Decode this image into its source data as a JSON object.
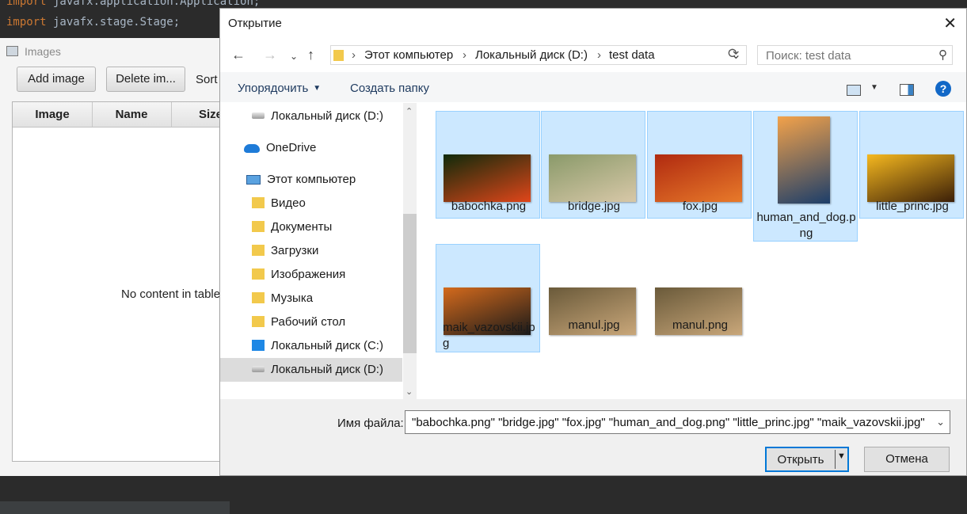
{
  "background_code": {
    "line1": {
      "kw": "import",
      "rest": " javafx.application.Application;"
    },
    "line2": {
      "kw": "import",
      "rest": " javafx.stage.Stage;"
    }
  },
  "app": {
    "title": "Images",
    "buttons": {
      "add": "Add image",
      "delete": "Delete im...",
      "sort": "Sort"
    },
    "table": {
      "columns": [
        "Image",
        "Name",
        "Size"
      ],
      "empty_text": "No content in table"
    }
  },
  "dialog": {
    "title": "Открытие",
    "close_icon": "close-icon",
    "address": {
      "crumbs": [
        "Этот компьютер",
        "Локальный диск (D:)",
        "test data"
      ]
    },
    "search": {
      "placeholder": "Поиск: test data"
    },
    "toolbar": {
      "organize": "Упорядочить",
      "new_folder": "Создать папку"
    },
    "nav_items": [
      {
        "label": "Локальный диск (D:)",
        "icon": "drive-icon"
      },
      {
        "label": "OneDrive",
        "icon": "cloud-icon"
      },
      {
        "label": "Этот компьютер",
        "icon": "computer-icon"
      },
      {
        "label": "Видео",
        "icon": "video-folder-icon"
      },
      {
        "label": "Документы",
        "icon": "documents-folder-icon"
      },
      {
        "label": "Загрузки",
        "icon": "downloads-folder-icon"
      },
      {
        "label": "Изображения",
        "icon": "pictures-folder-icon"
      },
      {
        "label": "Музыка",
        "icon": "music-folder-icon"
      },
      {
        "label": "Рабочий стол",
        "icon": "desktop-folder-icon"
      },
      {
        "label": "Локальный диск (C:)",
        "icon": "windows-drive-icon"
      },
      {
        "label": "Локальный диск (D:)",
        "icon": "drive-icon",
        "selected": true
      }
    ],
    "files": [
      {
        "name": "babochka.png",
        "selected": true,
        "thumb": [
          "#0f2a0a",
          "#e0461a"
        ]
      },
      {
        "name": "bridge.jpg",
        "selected": true,
        "thumb": [
          "#8a9a6a",
          "#d8c8a8"
        ]
      },
      {
        "name": "fox.jpg",
        "selected": true,
        "thumb": [
          "#b02a10",
          "#e87a2a"
        ]
      },
      {
        "name": "human_and_dog.png",
        "selected": true,
        "thumb": [
          "#f3a24a",
          "#1c3e6a"
        ]
      },
      {
        "name": "little_princ.jpg",
        "selected": true,
        "thumb": [
          "#f5b81f",
          "#3b1f08"
        ]
      },
      {
        "name": "maik_vazovskii.jpg",
        "selected": true,
        "thumb": [
          "#d46a1c",
          "#1a1a1a"
        ]
      },
      {
        "name": "manul.jpg",
        "selected": false,
        "thumb": [
          "#6a5a3a",
          "#c9a77a"
        ]
      },
      {
        "name": "manul.png",
        "selected": false,
        "thumb": [
          "#6a5a3a",
          "#c9a77a"
        ]
      }
    ],
    "filename_label": "Имя файла:",
    "filename_value": "\"babochka.png\" \"bridge.jpg\" \"fox.jpg\" \"human_and_dog.png\" \"little_princ.jpg\" \"maik_vazovskii.jpg\"",
    "buttons": {
      "open": "Открыть",
      "cancel": "Отмена"
    },
    "colors": {
      "selection": "#cce8ff",
      "accent": "#0078d7",
      "help": "#1268c7"
    }
  }
}
